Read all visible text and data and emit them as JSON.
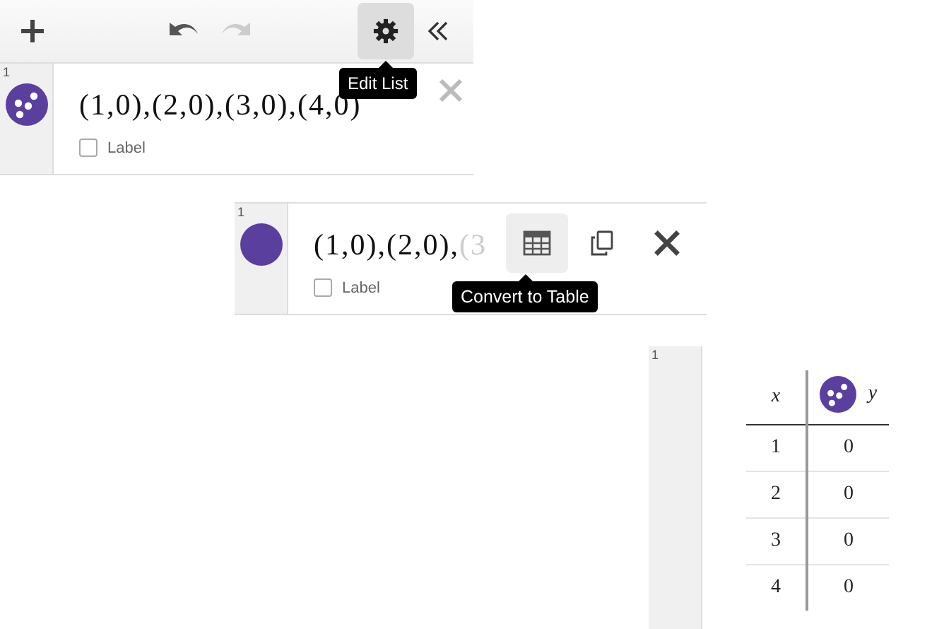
{
  "toolbar": {
    "undo": {
      "disabled": false
    },
    "redo": {
      "disabled": true
    },
    "settings": {
      "selected": true
    },
    "tooltip": "Edit List"
  },
  "list_expression": {
    "number": "1",
    "kind": "points",
    "color": "#5b3f9e",
    "text": "(1,0),(2,0),(3,0),(4,0)",
    "label_option": {
      "text": "Label",
      "checked": false
    }
  },
  "point_expression": {
    "number": "1",
    "kind": "dot",
    "color": "#5b3f9e",
    "text": "(1,0),(2,0),",
    "faded_text": "(3",
    "label_option": {
      "text": "Label",
      "checked": false
    },
    "table_button": {
      "selected": true
    },
    "tooltip": "Convert to Table"
  },
  "table_expression": {
    "number": "1",
    "kind": "points",
    "color": "#5b3f9e",
    "columns": [
      "x",
      "y"
    ],
    "rows": [
      [
        "1",
        "0"
      ],
      [
        "2",
        "0"
      ],
      [
        "3",
        "0"
      ],
      [
        "4",
        "0"
      ]
    ]
  }
}
